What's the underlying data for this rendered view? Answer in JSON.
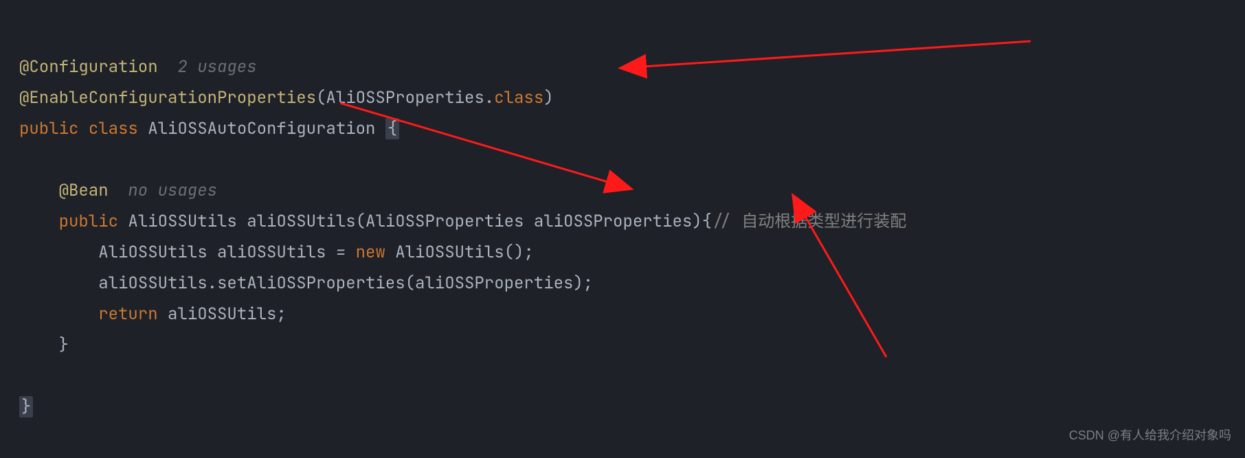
{
  "code": {
    "line1": {
      "annotation": "@Configuration",
      "usages": "  2 usages"
    },
    "line2": {
      "annotation": "@EnableConfigurationProperties",
      "lp": "(",
      "arg": "AliOSSProperties",
      "dot": ".",
      "cls": "class",
      "rp": ")"
    },
    "line3": {
      "kw1": "public ",
      "kw2": "class ",
      "name": "AliOSSAutoConfiguration ",
      "brace": "{"
    },
    "line4": "",
    "line5": {
      "indent": "    ",
      "annotation": "@Bean",
      "usages": "  no usages"
    },
    "line6": {
      "indent": "    ",
      "kw1": "public ",
      "ret": "AliOSSUtils ",
      "name": "aliOSSUtils",
      "lp": "(",
      "ptype": "AliOSSProperties ",
      "pname": "aliOSSProperties",
      "rp": ")",
      "brace": "{",
      "comment": "// 自动根据类型进行装配"
    },
    "line7": {
      "indent": "        ",
      "type": "AliOSSUtils ",
      "var": "aliOSSUtils ",
      "eq": "= ",
      "kw": "new ",
      "ctor": "AliOSSUtils",
      "paren": "();"
    },
    "line8": {
      "indent": "        ",
      "text": "aliOSSUtils.setAliOSSProperties(aliOSSProperties);"
    },
    "line9": {
      "indent": "        ",
      "kw": "return ",
      "var": "aliOSSUtils",
      "semi": ";"
    },
    "line10": {
      "indent": "    ",
      "brace": "}"
    },
    "line11": "",
    "line12": {
      "brace": "}"
    }
  },
  "watermark": "CSDN @有人给我介绍对象吗"
}
